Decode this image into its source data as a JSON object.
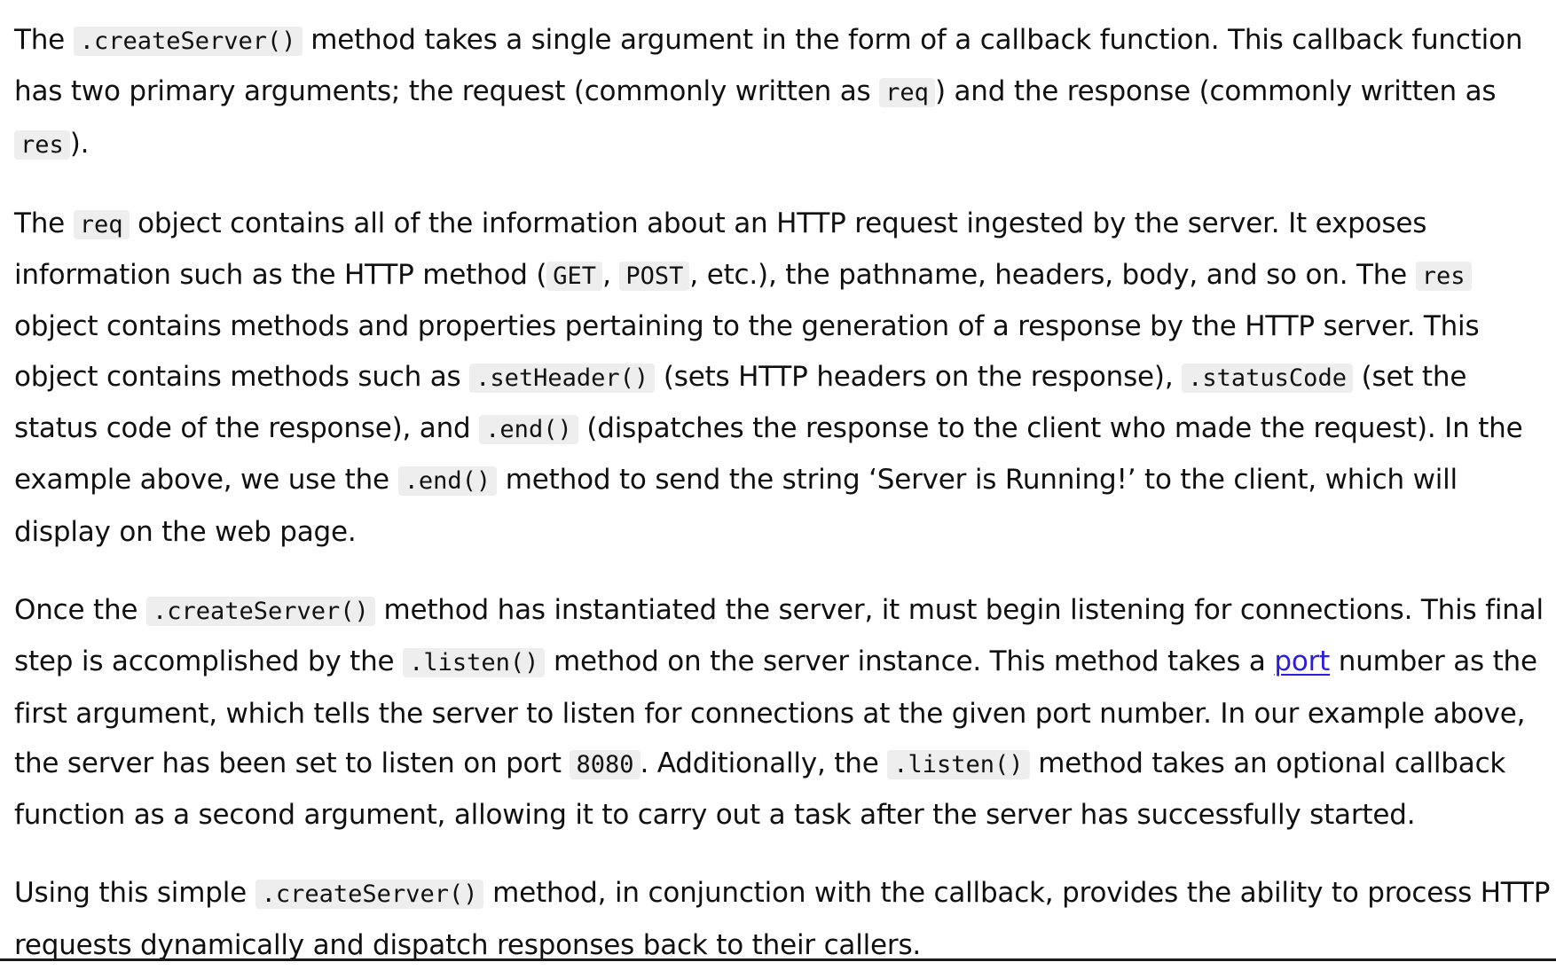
{
  "paragraphs": [
    {
      "segments": [
        {
          "type": "text",
          "text": "The "
        },
        {
          "type": "code",
          "text": ".createServer()"
        },
        {
          "type": "text",
          "text": " method takes a single argument in the form of a callback function. This callback function has two primary arguments; the request (commonly written as "
        },
        {
          "type": "code",
          "text": "req"
        },
        {
          "type": "text",
          "text": ") and the response (commonly written as "
        },
        {
          "type": "code",
          "text": "res"
        },
        {
          "type": "text",
          "text": ")."
        }
      ]
    },
    {
      "segments": [
        {
          "type": "text",
          "text": "The "
        },
        {
          "type": "code",
          "text": "req"
        },
        {
          "type": "text",
          "text": " object contains all of the information about an HTTP request ingested by the server. It exposes information such as the HTTP method ("
        },
        {
          "type": "code",
          "text": "GET"
        },
        {
          "type": "text",
          "text": ", "
        },
        {
          "type": "code",
          "text": "POST"
        },
        {
          "type": "text",
          "text": ", etc.), the pathname, headers, body, and so on. The "
        },
        {
          "type": "code",
          "text": "res"
        },
        {
          "type": "text",
          "text": " object contains methods and properties pertaining to the generation of a response by the HTTP server. This object contains methods such as "
        },
        {
          "type": "code",
          "text": ".setHeader()"
        },
        {
          "type": "text",
          "text": " (sets HTTP headers on the response), "
        },
        {
          "type": "code",
          "text": ".statusCode"
        },
        {
          "type": "text",
          "text": " (set the status code of the response), and "
        },
        {
          "type": "code",
          "text": ".end()"
        },
        {
          "type": "text",
          "text": " (dispatches the response to the client who made the request). In the example above, we use the "
        },
        {
          "type": "code",
          "text": ".end()"
        },
        {
          "type": "text",
          "text": " method to send the string ‘Server is Running!’ to the client, which will display on the web page."
        }
      ]
    },
    {
      "segments": [
        {
          "type": "text",
          "text": "Once the "
        },
        {
          "type": "code",
          "text": ".createServer()"
        },
        {
          "type": "text",
          "text": " method has instantiated the server, it must begin listening for connections. This final step is accomplished by the "
        },
        {
          "type": "code",
          "text": ".listen()"
        },
        {
          "type": "text",
          "text": " method on the server instance. This method takes a "
        },
        {
          "type": "link",
          "text": "port"
        },
        {
          "type": "text",
          "text": " number as the first argument, which tells the server to listen for connections at the given port number. In our example above, the server has been set to listen on port "
        },
        {
          "type": "code",
          "text": "8080"
        },
        {
          "type": "text",
          "text": ". Additionally, the "
        },
        {
          "type": "code",
          "text": ".listen()"
        },
        {
          "type": "text",
          "text": " method takes an optional callback function as a second argument, allowing it to carry out a task after the server has successfully started."
        }
      ]
    },
    {
      "segments": [
        {
          "type": "text",
          "text": "Using this simple "
        },
        {
          "type": "code",
          "text": ".createServer()"
        },
        {
          "type": "text",
          "text": " method, in conjunction with the callback, provides the ability to process HTTP requests dynamically and dispatch responses back to their callers."
        }
      ]
    }
  ],
  "colors": {
    "text": "#101010",
    "code_background": "#eeeeef",
    "link": "#2b1de0"
  }
}
